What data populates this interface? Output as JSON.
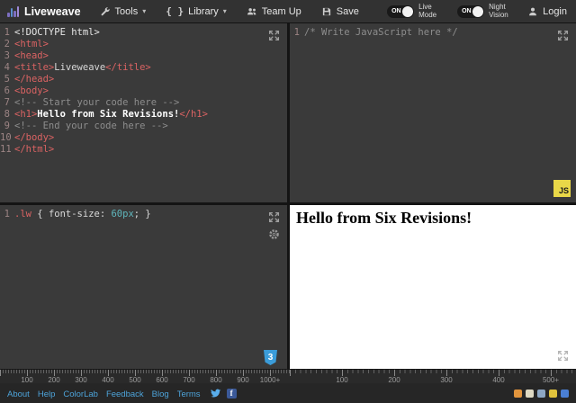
{
  "topbar": {
    "brand": "Liveweave",
    "menus": [
      {
        "label": "Tools"
      },
      {
        "label": "Library"
      },
      {
        "label": "Team Up"
      },
      {
        "label": "Save"
      }
    ],
    "toggles": [
      {
        "state": "ON",
        "label": "Live Mode"
      },
      {
        "state": "ON",
        "label": "Night Vision"
      }
    ],
    "login_label": "Login"
  },
  "icons": {
    "caret": "▾",
    "braces": "{ }",
    "facebook_glyph": "f"
  },
  "editors": {
    "html": {
      "lines": [
        {
          "num": "1",
          "segs": [
            {
              "t": "<!DOCTYPE html>",
              "c": "meta"
            }
          ]
        },
        {
          "num": "2",
          "segs": [
            {
              "t": "<html>",
              "c": "tag"
            }
          ]
        },
        {
          "num": "3",
          "segs": [
            {
              "t": "<head>",
              "c": "tag"
            }
          ]
        },
        {
          "num": "4",
          "segs": [
            {
              "t": "<title>",
              "c": "tag"
            },
            {
              "t": "Liveweave",
              "c": "plain"
            },
            {
              "t": "</title>",
              "c": "tag"
            }
          ]
        },
        {
          "num": "5",
          "segs": [
            {
              "t": "</head>",
              "c": "tag"
            }
          ]
        },
        {
          "num": "6",
          "segs": [
            {
              "t": "<body>",
              "c": "tag"
            }
          ]
        },
        {
          "num": "7",
          "segs": [
            {
              "t": "<!-- Start your code here -->",
              "c": "comment"
            }
          ]
        },
        {
          "num": "8",
          "segs": [
            {
              "t": "<h1>",
              "c": "tag"
            },
            {
              "t": "Hello from Six Revisions!",
              "c": "bold"
            },
            {
              "t": "</h1>",
              "c": "tag"
            }
          ]
        },
        {
          "num": "9",
          "segs": [
            {
              "t": "<!-- End your code here -->",
              "c": "comment"
            }
          ]
        },
        {
          "num": "10",
          "segs": [
            {
              "t": "</body>",
              "c": "tag"
            }
          ]
        },
        {
          "num": "11",
          "segs": [
            {
              "t": "</html>",
              "c": "tag"
            }
          ]
        }
      ]
    },
    "css": {
      "lines": [
        {
          "num": "1",
          "segs": [
            {
              "t": ".lw",
              "c": "selector"
            },
            {
              "t": " { ",
              "c": "plain"
            },
            {
              "t": "font-size:",
              "c": "plain"
            },
            {
              "t": " ",
              "c": "plain"
            },
            {
              "t": "60px",
              "c": "value"
            },
            {
              "t": ";",
              "c": "plain"
            },
            {
              "t": " }",
              "c": "plain"
            }
          ]
        }
      ]
    },
    "js": {
      "lines": [
        {
          "num": "1",
          "segs": [
            {
              "t": "/* Write JavaScript here */",
              "c": "comment"
            }
          ]
        }
      ]
    }
  },
  "badges": {
    "js": "JS",
    "css": "3"
  },
  "preview": {
    "heading": "Hello from Six Revisions!"
  },
  "ruler": {
    "left": {
      "labels": [
        "100",
        "200",
        "300",
        "400",
        "500",
        "600",
        "700",
        "800",
        "900",
        "1000+"
      ],
      "spacing": 30
    },
    "right": {
      "labels": [
        "100",
        "200",
        "300",
        "400",
        "500+"
      ],
      "spacing": 58
    }
  },
  "footer": {
    "links": [
      "About",
      "Help",
      "ColorLab",
      "Feedback",
      "Blog",
      "Terms"
    ],
    "mini_badges": [
      "#e2953d",
      "#ded9c3",
      "#8da7c4",
      "#e0c23c",
      "#4a7fd4"
    ]
  },
  "colors": {
    "js_badge": "#e9d848",
    "css_badge": "#3b9cd9",
    "link_blue": "#4da3d9",
    "tag_red": "#db6363",
    "toggle_on_knob": "#f2f2f2"
  }
}
